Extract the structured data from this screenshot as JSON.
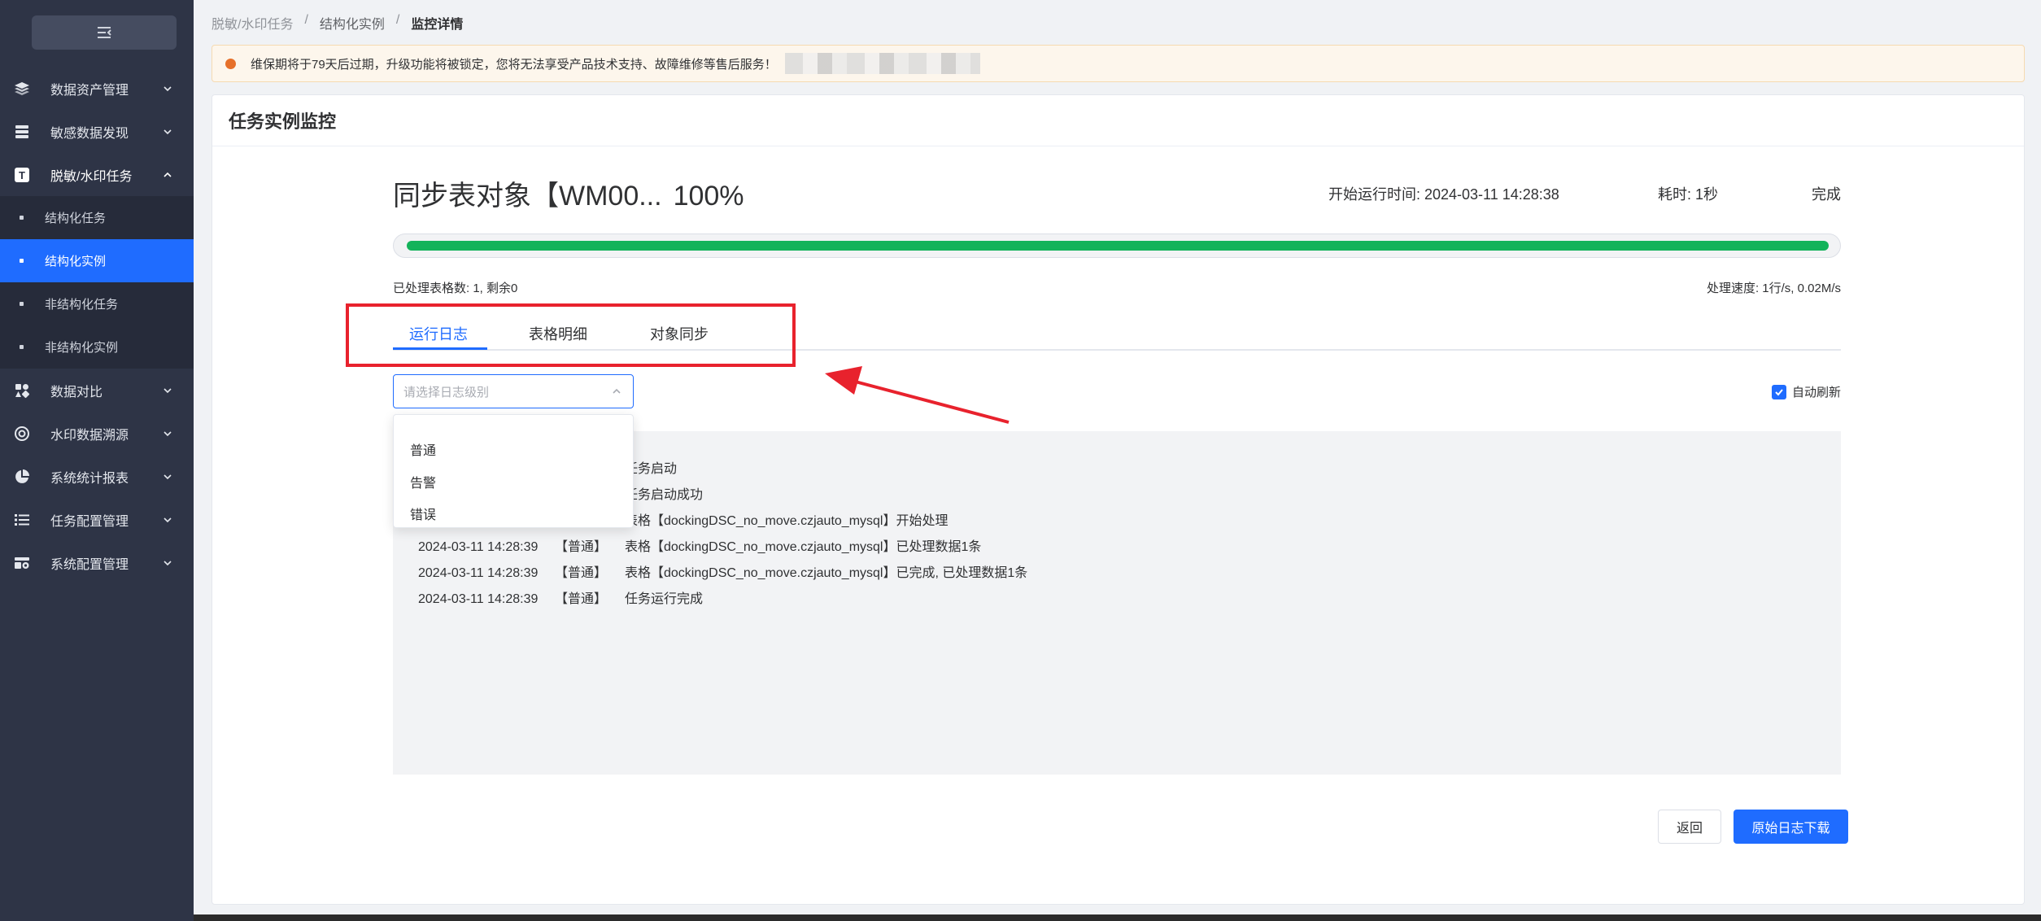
{
  "sidebar": {
    "items": [
      {
        "label": "数据资产管理",
        "icon": "layers-icon"
      },
      {
        "label": "敏感数据发现",
        "icon": "database-icon"
      },
      {
        "label": "脱敏/水印任务",
        "icon": "text-t-icon"
      },
      {
        "label": "数据对比",
        "icon": "tools-icon"
      },
      {
        "label": "水印数据溯源",
        "icon": "target-icon"
      },
      {
        "label": "系统统计报表",
        "icon": "pie-chart-icon"
      },
      {
        "label": "任务配置管理",
        "icon": "list-icon"
      },
      {
        "label": "系统配置管理",
        "icon": "settings-panel-icon"
      }
    ],
    "submenu": [
      "结构化任务",
      "结构化实例",
      "非结构化任务",
      "非结构化实例"
    ]
  },
  "breadcrumb": [
    "脱敏/水印任务",
    "结构化实例",
    "监控详情"
  ],
  "notice": "维保期将于79天后过期，升级功能将被锁定，您将无法享受产品技术支持、故障维修等售后服务！",
  "card_title": "任务实例监控",
  "task": {
    "title": "同步表对象【WM00...",
    "percent": "100%",
    "progress": 1.0,
    "start_time": "开始运行时间: 2024-03-11 14:28:38",
    "duration": "耗时: 1秒",
    "status": "完成",
    "processed": "已处理表格数: 1, 剩余0",
    "speed": "处理速度: 1行/s, 0.02M/s"
  },
  "tabs": [
    "运行日志",
    "表格明细",
    "对象同步"
  ],
  "log_level_select": {
    "placeholder": "请选择日志级别",
    "options": [
      "普通",
      "告警",
      "错误"
    ]
  },
  "auto_refresh": "自动刷新",
  "logs": [
    {
      "time": "",
      "level": "",
      "msg": "任务启动"
    },
    {
      "time": "",
      "level": "",
      "msg": "任务启动成功"
    },
    {
      "time": "",
      "level": "",
      "msg": "表格【dockingDSC_no_move.czjauto_mysql】开始处理"
    },
    {
      "time": "2024-03-11 14:28:39",
      "level": "【普通】",
      "msg": "表格【dockingDSC_no_move.czjauto_mysql】已处理数据1条"
    },
    {
      "time": "2024-03-11 14:28:39",
      "level": "【普通】",
      "msg": "表格【dockingDSC_no_move.czjauto_mysql】已完成, 已处理数据1条"
    },
    {
      "time": "2024-03-11 14:28:39",
      "level": "【普通】",
      "msg": "任务运行完成"
    }
  ],
  "buttons": {
    "back": "返回",
    "download": "原始日志下载"
  },
  "colors": {
    "primary": "#1f6cff",
    "progress": "#13b35a",
    "annotation": "#e8222d",
    "sidebar": "#2e3446"
  }
}
